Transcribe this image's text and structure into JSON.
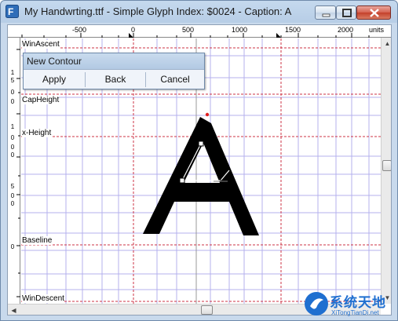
{
  "window": {
    "title": "My Handwrting.ttf - Simple Glyph Index: $0024 - Caption: A"
  },
  "ruler": {
    "top_labels": [
      "-500",
      "0",
      "500",
      "1000",
      "1500",
      "2000"
    ],
    "unit_label": "units",
    "left_digit_groups": [
      [
        "1",
        "5",
        "0",
        "0"
      ],
      [
        "1",
        "0",
        "0",
        "0"
      ],
      [
        "5",
        "0",
        "0"
      ],
      [
        "0"
      ]
    ]
  },
  "metrics": {
    "win_ascent": "WinAscent",
    "cap_height": "CapHeight",
    "x_height": "x-Height",
    "baseline": "Baseline",
    "win_descent": "WinDescent"
  },
  "dialog": {
    "title": "New Contour",
    "apply_label": "Apply",
    "back_label": "Back",
    "cancel_label": "Cancel"
  },
  "watermark": {
    "title": "系统天地",
    "subtitle": "XiTongTianDi.net"
  },
  "colors": {
    "grid_line": "#b4b0ee",
    "metric_line": "#cc3344",
    "glyph_fill": "#000000",
    "watermark_blue": "#1f6fd0"
  }
}
